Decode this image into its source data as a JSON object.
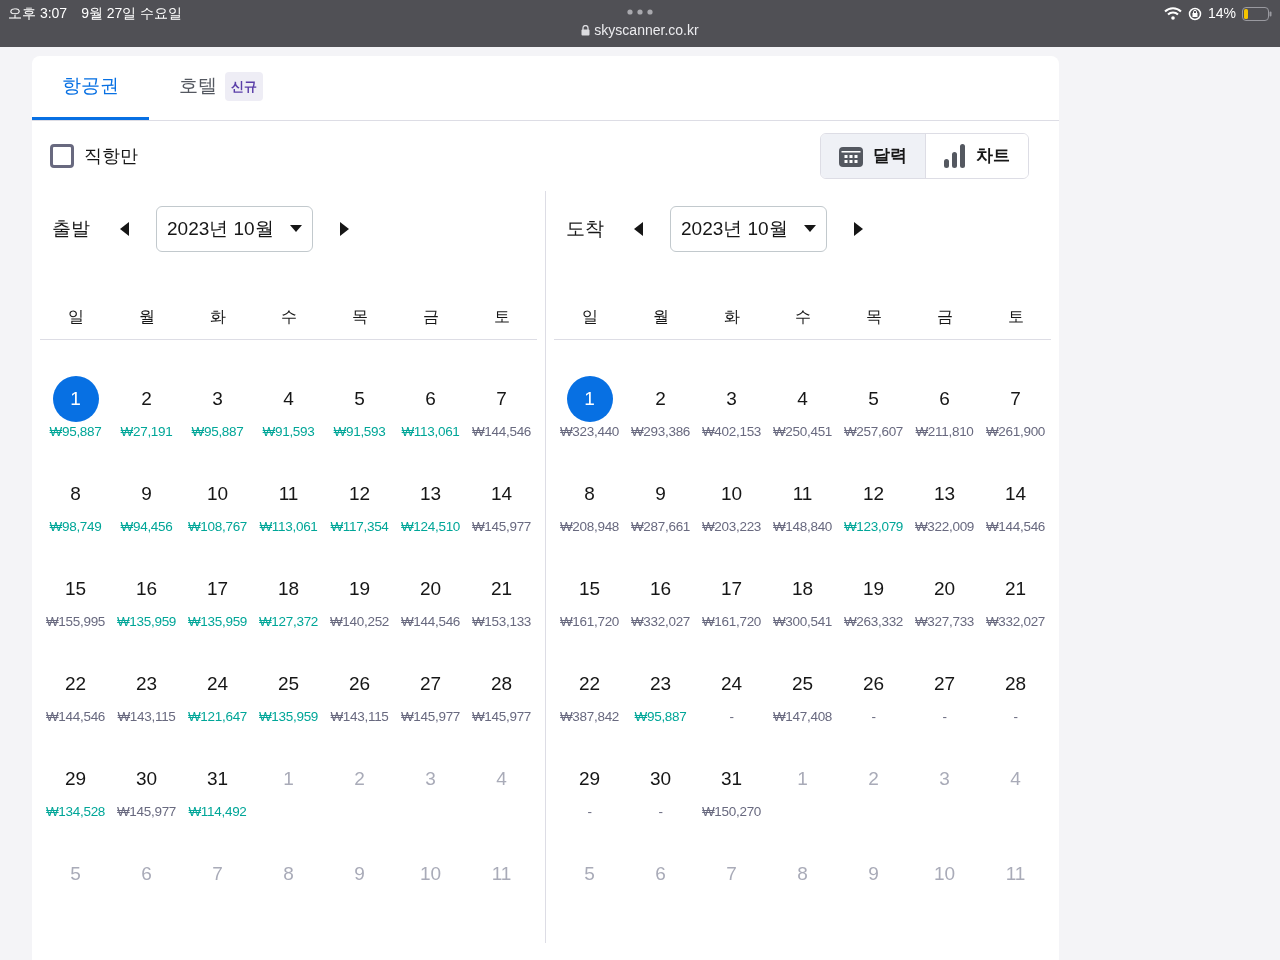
{
  "status_bar": {
    "time": "오후 3:07",
    "date": "9월 27일 수요일",
    "url": "skyscanner.co.kr",
    "battery": "14%"
  },
  "tabs": [
    {
      "label": "항공권",
      "selected": true
    },
    {
      "label": "호텔",
      "selected": false,
      "badge": "신규"
    }
  ],
  "direct_only": {
    "label": "직항만",
    "checked": false
  },
  "view_toggle": [
    {
      "label": "달력",
      "kind": "calendar",
      "selected": true
    },
    {
      "label": "차트",
      "kind": "chart",
      "selected": false
    }
  ],
  "calendars": [
    {
      "label": "출발",
      "month": "2023년 10월",
      "weekdays": [
        "일",
        "월",
        "화",
        "수",
        "목",
        "금",
        "토"
      ],
      "days": [
        {
          "day": "1",
          "kind": "current",
          "selected": true,
          "price": "₩95,887",
          "cheap": true
        },
        {
          "day": "2",
          "kind": "current",
          "selected": false,
          "price": "₩27,191",
          "cheap": true
        },
        {
          "day": "3",
          "kind": "current",
          "selected": false,
          "price": "₩95,887",
          "cheap": true
        },
        {
          "day": "4",
          "kind": "current",
          "selected": false,
          "price": "₩91,593",
          "cheap": true
        },
        {
          "day": "5",
          "kind": "current",
          "selected": false,
          "price": "₩91,593",
          "cheap": true
        },
        {
          "day": "6",
          "kind": "current",
          "selected": false,
          "price": "₩113,061",
          "cheap": true
        },
        {
          "day": "7",
          "kind": "current",
          "selected": false,
          "price": "₩144,546",
          "cheap": false
        },
        {
          "day": "8",
          "kind": "current",
          "selected": false,
          "price": "₩98,749",
          "cheap": true
        },
        {
          "day": "9",
          "kind": "current",
          "selected": false,
          "price": "₩94,456",
          "cheap": true
        },
        {
          "day": "10",
          "kind": "current",
          "selected": false,
          "price": "₩108,767",
          "cheap": true
        },
        {
          "day": "11",
          "kind": "current",
          "selected": false,
          "price": "₩113,061",
          "cheap": true
        },
        {
          "day": "12",
          "kind": "current",
          "selected": false,
          "price": "₩117,354",
          "cheap": true
        },
        {
          "day": "13",
          "kind": "current",
          "selected": false,
          "price": "₩124,510",
          "cheap": true
        },
        {
          "day": "14",
          "kind": "current",
          "selected": false,
          "price": "₩145,977",
          "cheap": false
        },
        {
          "day": "15",
          "kind": "current",
          "selected": false,
          "price": "₩155,995",
          "cheap": false
        },
        {
          "day": "16",
          "kind": "current",
          "selected": false,
          "price": "₩135,959",
          "cheap": true
        },
        {
          "day": "17",
          "kind": "current",
          "selected": false,
          "price": "₩135,959",
          "cheap": true
        },
        {
          "day": "18",
          "kind": "current",
          "selected": false,
          "price": "₩127,372",
          "cheap": true
        },
        {
          "day": "19",
          "kind": "current",
          "selected": false,
          "price": "₩140,252",
          "cheap": false
        },
        {
          "day": "20",
          "kind": "current",
          "selected": false,
          "price": "₩144,546",
          "cheap": false
        },
        {
          "day": "21",
          "kind": "current",
          "selected": false,
          "price": "₩153,133",
          "cheap": false
        },
        {
          "day": "22",
          "kind": "current",
          "selected": false,
          "price": "₩144,546",
          "cheap": false
        },
        {
          "day": "23",
          "kind": "current",
          "selected": false,
          "price": "₩143,115",
          "cheap": false
        },
        {
          "day": "24",
          "kind": "current",
          "selected": false,
          "price": "₩121,647",
          "cheap": true
        },
        {
          "day": "25",
          "kind": "current",
          "selected": false,
          "price": "₩135,959",
          "cheap": true
        },
        {
          "day": "26",
          "kind": "current",
          "selected": false,
          "price": "₩143,115",
          "cheap": false
        },
        {
          "day": "27",
          "kind": "current",
          "selected": false,
          "price": "₩145,977",
          "cheap": false
        },
        {
          "day": "28",
          "kind": "current",
          "selected": false,
          "price": "₩145,977",
          "cheap": false
        },
        {
          "day": "29",
          "kind": "current",
          "selected": false,
          "price": "₩134,528",
          "cheap": true
        },
        {
          "day": "30",
          "kind": "current",
          "selected": false,
          "price": "₩145,977",
          "cheap": false
        },
        {
          "day": "31",
          "kind": "current",
          "selected": false,
          "price": "₩114,492",
          "cheap": true
        },
        {
          "day": "1",
          "kind": "other",
          "selected": false
        },
        {
          "day": "2",
          "kind": "other",
          "selected": false
        },
        {
          "day": "3",
          "kind": "other",
          "selected": false
        },
        {
          "day": "4",
          "kind": "other",
          "selected": false
        },
        {
          "day": "5",
          "kind": "other",
          "selected": false
        },
        {
          "day": "6",
          "kind": "other",
          "selected": false
        },
        {
          "day": "7",
          "kind": "other",
          "selected": false
        },
        {
          "day": "8",
          "kind": "other",
          "selected": false
        },
        {
          "day": "9",
          "kind": "other",
          "selected": false
        },
        {
          "day": "10",
          "kind": "other",
          "selected": false
        },
        {
          "day": "11",
          "kind": "other",
          "selected": false
        }
      ]
    },
    {
      "label": "도착",
      "month": "2023년 10월",
      "weekdays": [
        "일",
        "월",
        "화",
        "수",
        "목",
        "금",
        "토"
      ],
      "days": [
        {
          "day": "1",
          "kind": "current",
          "selected": true,
          "price": "₩323,440",
          "cheap": false
        },
        {
          "day": "2",
          "kind": "current",
          "selected": false,
          "price": "₩293,386",
          "cheap": false
        },
        {
          "day": "3",
          "kind": "current",
          "selected": false,
          "price": "₩402,153",
          "cheap": false
        },
        {
          "day": "4",
          "kind": "current",
          "selected": false,
          "price": "₩250,451",
          "cheap": false
        },
        {
          "day": "5",
          "kind": "current",
          "selected": false,
          "price": "₩257,607",
          "cheap": false
        },
        {
          "day": "6",
          "kind": "current",
          "selected": false,
          "price": "₩211,810",
          "cheap": false
        },
        {
          "day": "7",
          "kind": "current",
          "selected": false,
          "price": "₩261,900",
          "cheap": false
        },
        {
          "day": "8",
          "kind": "current",
          "selected": false,
          "price": "₩208,948",
          "cheap": false
        },
        {
          "day": "9",
          "kind": "current",
          "selected": false,
          "price": "₩287,661",
          "cheap": false
        },
        {
          "day": "10",
          "kind": "current",
          "selected": false,
          "price": "₩203,223",
          "cheap": false
        },
        {
          "day": "11",
          "kind": "current",
          "selected": false,
          "price": "₩148,840",
          "cheap": false
        },
        {
          "day": "12",
          "kind": "current",
          "selected": false,
          "price": "₩123,079",
          "cheap": true
        },
        {
          "day": "13",
          "kind": "current",
          "selected": false,
          "price": "₩322,009",
          "cheap": false
        },
        {
          "day": "14",
          "kind": "current",
          "selected": false,
          "price": "₩144,546",
          "cheap": false
        },
        {
          "day": "15",
          "kind": "current",
          "selected": false,
          "price": "₩161,720",
          "cheap": false
        },
        {
          "day": "16",
          "kind": "current",
          "selected": false,
          "price": "₩332,027",
          "cheap": false
        },
        {
          "day": "17",
          "kind": "current",
          "selected": false,
          "price": "₩161,720",
          "cheap": false
        },
        {
          "day": "18",
          "kind": "current",
          "selected": false,
          "price": "₩300,541",
          "cheap": false
        },
        {
          "day": "19",
          "kind": "current",
          "selected": false,
          "price": "₩263,332",
          "cheap": false
        },
        {
          "day": "20",
          "kind": "current",
          "selected": false,
          "price": "₩327,733",
          "cheap": false
        },
        {
          "day": "21",
          "kind": "current",
          "selected": false,
          "price": "₩332,027",
          "cheap": false
        },
        {
          "day": "22",
          "kind": "current",
          "selected": false,
          "price": "₩387,842",
          "cheap": false
        },
        {
          "day": "23",
          "kind": "current",
          "selected": false,
          "price": "₩95,887",
          "cheap": true
        },
        {
          "day": "24",
          "kind": "current",
          "selected": false,
          "price": "-",
          "cheap": false
        },
        {
          "day": "25",
          "kind": "current",
          "selected": false,
          "price": "₩147,408",
          "cheap": false
        },
        {
          "day": "26",
          "kind": "current",
          "selected": false,
          "price": "-",
          "cheap": false
        },
        {
          "day": "27",
          "kind": "current",
          "selected": false,
          "price": "-",
          "cheap": false
        },
        {
          "day": "28",
          "kind": "current",
          "selected": false,
          "price": "-",
          "cheap": false
        },
        {
          "day": "29",
          "kind": "current",
          "selected": false,
          "price": "-",
          "cheap": false
        },
        {
          "day": "30",
          "kind": "current",
          "selected": false,
          "price": "-",
          "cheap": false
        },
        {
          "day": "31",
          "kind": "current",
          "selected": false,
          "price": "₩150,270",
          "cheap": false
        },
        {
          "day": "1",
          "kind": "other",
          "selected": false
        },
        {
          "day": "2",
          "kind": "other",
          "selected": false
        },
        {
          "day": "3",
          "kind": "other",
          "selected": false
        },
        {
          "day": "4",
          "kind": "other",
          "selected": false
        },
        {
          "day": "5",
          "kind": "other",
          "selected": false
        },
        {
          "day": "6",
          "kind": "other",
          "selected": false
        },
        {
          "day": "7",
          "kind": "other",
          "selected": false
        },
        {
          "day": "8",
          "kind": "other",
          "selected": false
        },
        {
          "day": "9",
          "kind": "other",
          "selected": false
        },
        {
          "day": "10",
          "kind": "other",
          "selected": false
        },
        {
          "day": "11",
          "kind": "other",
          "selected": false
        }
      ]
    }
  ]
}
